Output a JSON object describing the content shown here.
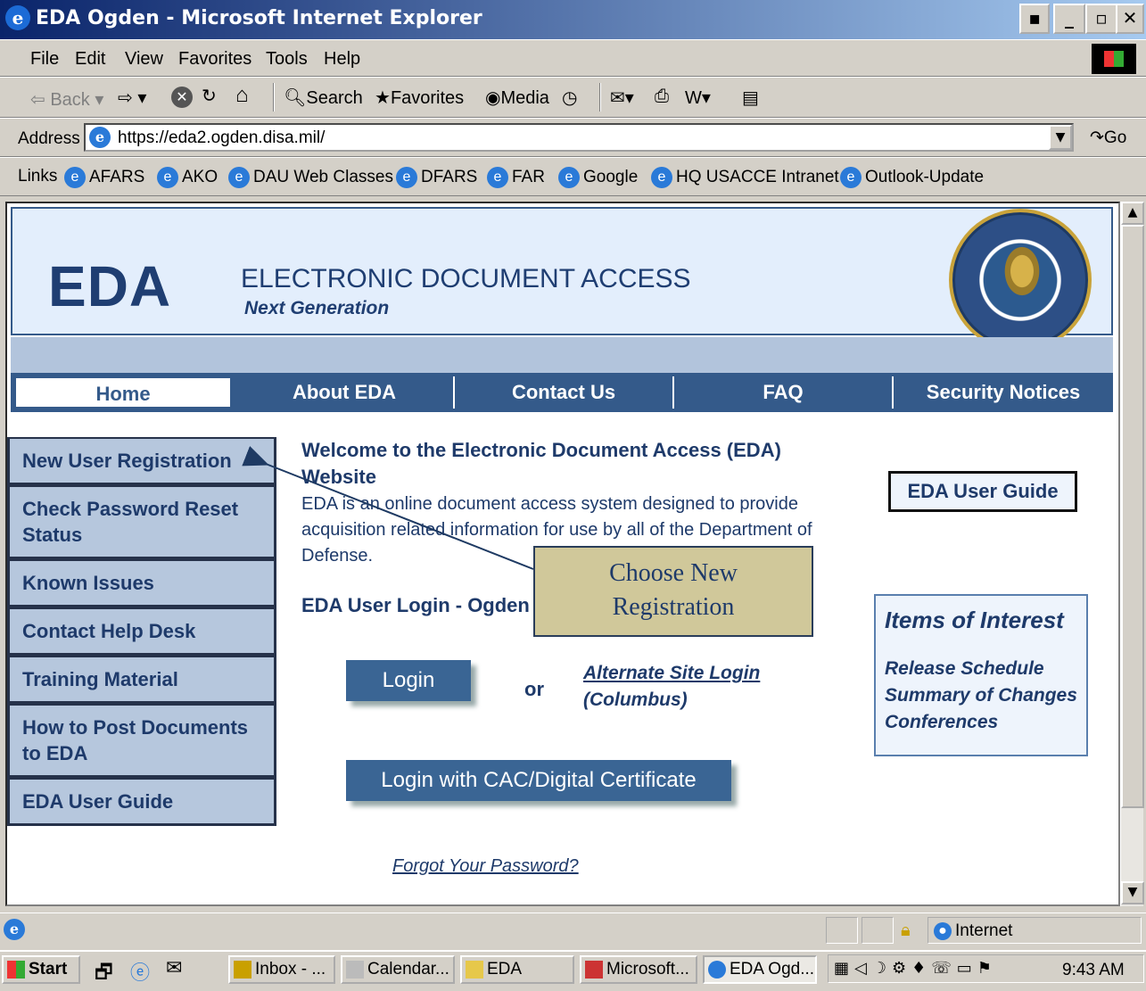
{
  "window": {
    "title": "EDA Ogden - Microsoft Internet Explorer"
  },
  "menu": [
    "File",
    "Edit",
    "View",
    "Favorites",
    "Tools",
    "Help"
  ],
  "toolbar": {
    "back": "Back",
    "search": "Search",
    "favorites": "Favorites",
    "media": "Media"
  },
  "address": {
    "label": "Address",
    "url": "https://eda2.ogden.disa.mil/",
    "go": "Go"
  },
  "links": {
    "label": "Links",
    "items": [
      "AFARS",
      "AKO",
      "DAU Web Classes",
      "DFARS",
      "FAR",
      "Google",
      "HQ USACCE Intranet",
      "Outlook-Update"
    ]
  },
  "header": {
    "logo": "EDA",
    "title": "ELECTRONIC DOCUMENT ACCESS",
    "subtitle": "Next Generation"
  },
  "nav": [
    "Home",
    "About EDA",
    "Contact Us",
    "FAQ",
    "Security Notices"
  ],
  "sidebar": [
    "New User Registration",
    "Check Password Reset Status",
    "Known Issues",
    "Contact Help Desk",
    "Training Material",
    "How to Post Documents to EDA",
    "EDA User Guide"
  ],
  "main": {
    "welcome": "Welcome to the Electronic Document Access (EDA) Website",
    "intro": "EDA is an online document access system designed to provide acquisition related information for use by all of the Department of Defense.",
    "login_heading": "EDA User Login - Ogden",
    "login_button": "Login",
    "or": "or",
    "alt_login": "Alternate Site Login",
    "alt_login_sub": "(Columbus)",
    "cac_button": "Login with CAC/Digital Certificate",
    "forgot": "Forgot Your Password?"
  },
  "right": {
    "guide_button": "EDA User Guide",
    "interest_title": "Items of Interest",
    "interest_items": [
      "Release Schedule",
      "Summary of Changes",
      "Conferences"
    ]
  },
  "callout": {
    "line1": "Choose New",
    "line2": "Registration"
  },
  "status": {
    "zone": "Internet"
  },
  "taskbar": {
    "start": "Start",
    "items": [
      "Inbox - ...",
      "Calendar...",
      "EDA",
      "Microsoft...",
      "EDA Ogd..."
    ],
    "clock": "9:43 AM"
  }
}
